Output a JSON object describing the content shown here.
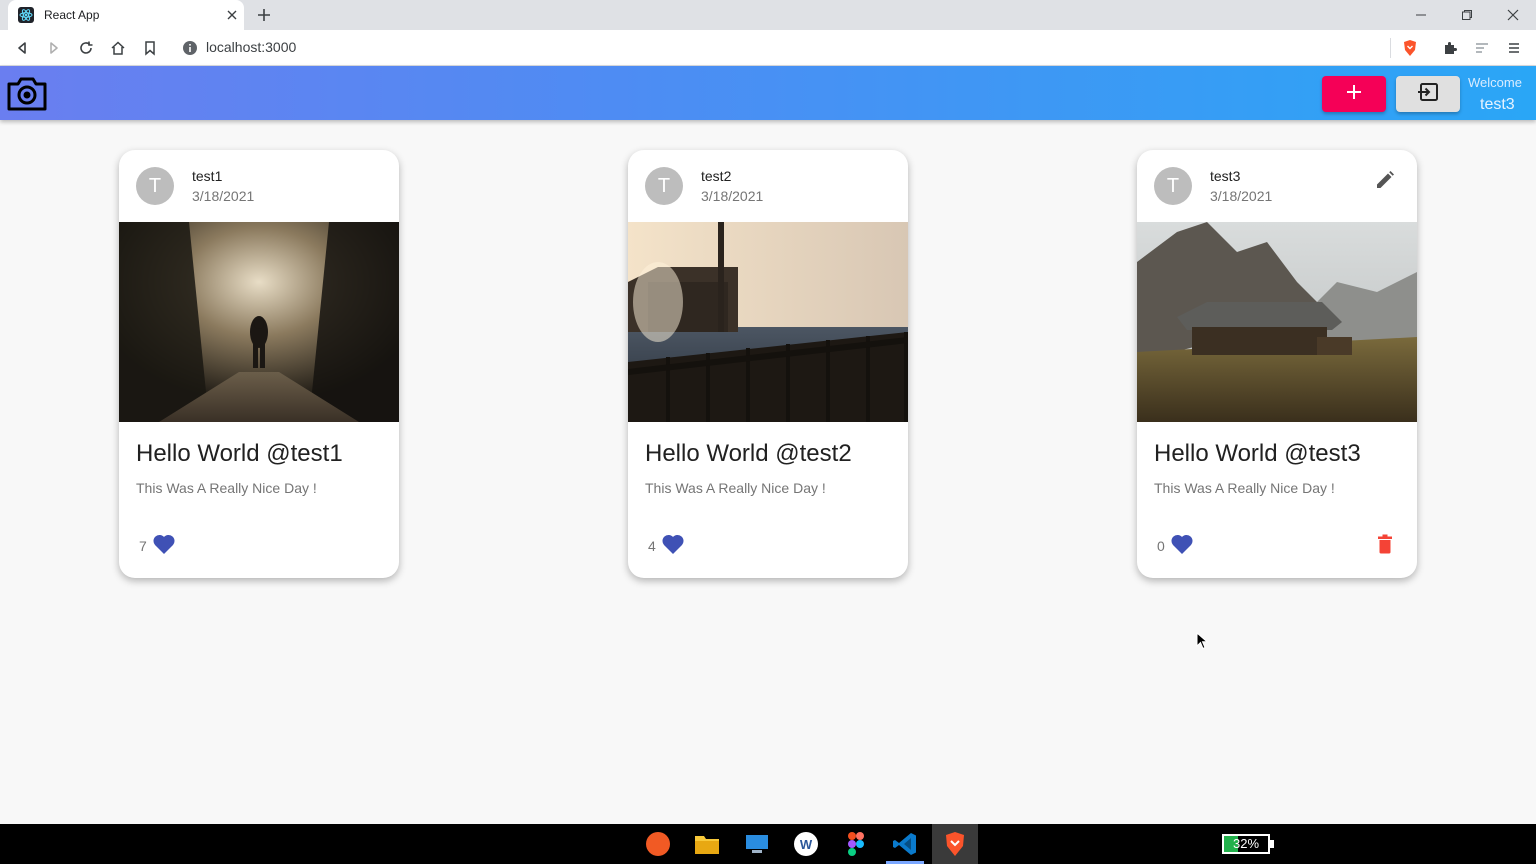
{
  "browser": {
    "tab_title": "React App",
    "url": "localhost:3000"
  },
  "appbar": {
    "welcome_label": "Welcome",
    "username": "test3",
    "add_icon": "plus-icon",
    "logout_icon": "exit-icon",
    "logo_icon": "camera-icon"
  },
  "posts": [
    {
      "avatar_letter": "T",
      "username": "test1",
      "date": "3/18/2021",
      "title": "Hello World @test1",
      "description": "This Was A Really Nice Day !",
      "likes": "7",
      "editable": false,
      "image": "hiker on foggy forest path"
    },
    {
      "avatar_letter": "T",
      "username": "test2",
      "date": "3/18/2021",
      "title": "Hello World @test2",
      "description": "This Was A Really Nice Day !",
      "likes": "4",
      "editable": false,
      "image": "pier and hut by the sea at sunset"
    },
    {
      "avatar_letter": "T",
      "username": "test3",
      "date": "3/18/2021",
      "title": "Hello World @test3",
      "description": "This Was A Really Nice Day !",
      "likes": "0",
      "editable": true,
      "image": "mountain cabin in grassland"
    }
  ],
  "taskbar": {
    "battery_percent": "32%",
    "battery_level": 0.32,
    "apps": [
      "compass-icon",
      "folder-icon",
      "desktop-icon",
      "word-icon",
      "figma-icon",
      "vscode-icon",
      "brave-icon"
    ]
  },
  "colors": {
    "appbar_start": "#6a7ef0",
    "appbar_end": "#2aa6f6",
    "accent_pink": "#f50057",
    "like_blue": "#3f51b5",
    "delete_red": "#f44336"
  }
}
